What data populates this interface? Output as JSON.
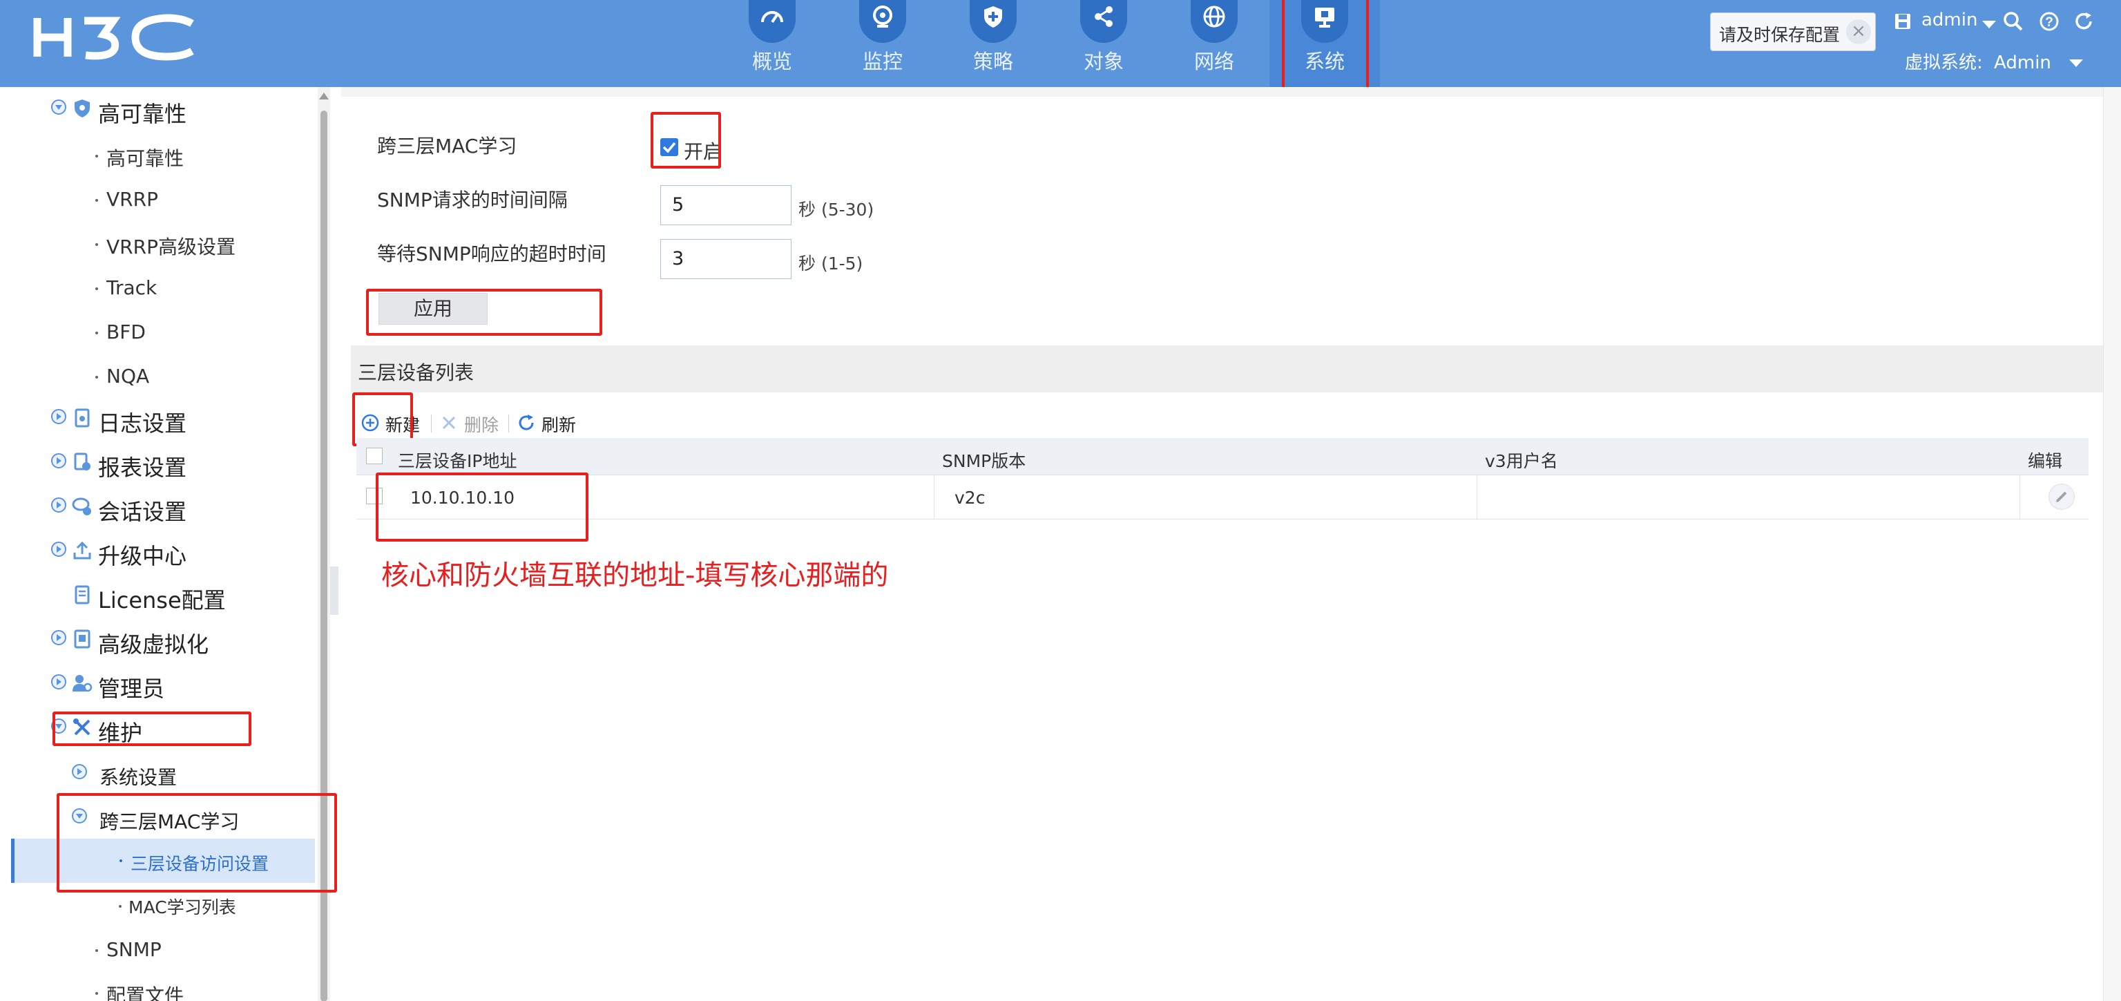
{
  "header": {
    "logo_text": "H3C",
    "nav": [
      {
        "label": "概览",
        "icon": "dashboard-icon"
      },
      {
        "label": "监控",
        "icon": "monitor-icon"
      },
      {
        "label": "策略",
        "icon": "shield-plus-icon"
      },
      {
        "label": "对象",
        "icon": "share-nodes-icon"
      },
      {
        "label": "网络",
        "icon": "globe-icon"
      },
      {
        "label": "系统",
        "icon": "system-screen-icon",
        "active": true
      }
    ],
    "save_tip": "请及时保存配置",
    "user": "admin",
    "virtual_system_label": "虚拟系统:",
    "virtual_system_value": "Admin"
  },
  "sidebar": {
    "groups": [
      {
        "label": "高可靠性",
        "icon": "shield-icon",
        "expanded": true
      },
      {
        "label": "日志设置",
        "icon": "log-icon"
      },
      {
        "label": "报表设置",
        "icon": "report-icon"
      },
      {
        "label": "会话设置",
        "icon": "session-icon"
      },
      {
        "label": "升级中心",
        "icon": "upload-icon"
      },
      {
        "label": "License配置",
        "icon": "license-icon"
      },
      {
        "label": "高级虚拟化",
        "icon": "virtualization-icon"
      },
      {
        "label": "管理员",
        "icon": "admin-users-icon"
      },
      {
        "label": "维护",
        "icon": "tools-icon",
        "expanded": true
      }
    ],
    "ha_items": [
      "高可靠性",
      "VRRP",
      "VRRP高级设置",
      "Track",
      "BFD",
      "NQA"
    ],
    "maintenance": {
      "system_settings": "系统设置",
      "cross_l3_mac": "跨三层MAC学习",
      "cross_l3_children": [
        "三层设备访问设置",
        "MAC学习列表"
      ],
      "snmp": "SNMP",
      "config_file": "配置文件"
    }
  },
  "form": {
    "cross_l3_label": "跨三层MAC学习",
    "enable_label": "开启",
    "enable_checked": true,
    "snmp_interval_label": "SNMP请求的时间间隔",
    "snmp_interval_value": "5",
    "snmp_interval_unit": "秒 (5-30)",
    "snmp_timeout_label": "等待SNMP响应的超时时间",
    "snmp_timeout_value": "3",
    "snmp_timeout_unit": "秒 (1-5)",
    "apply_label": "应用"
  },
  "device_list": {
    "title": "三层设备列表",
    "toolbar": {
      "new": "新建",
      "delete": "删除",
      "refresh": "刷新"
    },
    "columns": [
      "三层设备IP地址",
      "SNMP版本",
      "v3用户名",
      "编辑"
    ],
    "rows": [
      {
        "ip": "10.10.10.10",
        "snmp_version": "v2c",
        "v3_user": ""
      }
    ]
  },
  "annotation": "核心和防火墙互联的地址-填写核心那端的",
  "colors": {
    "header_bg": "#5b95dc",
    "nav_icon_bg": "#2f6fc4",
    "annotation_red": "#e62020",
    "selected_bg": "#d7e6f8",
    "accent_blue": "#2e7ae0"
  }
}
